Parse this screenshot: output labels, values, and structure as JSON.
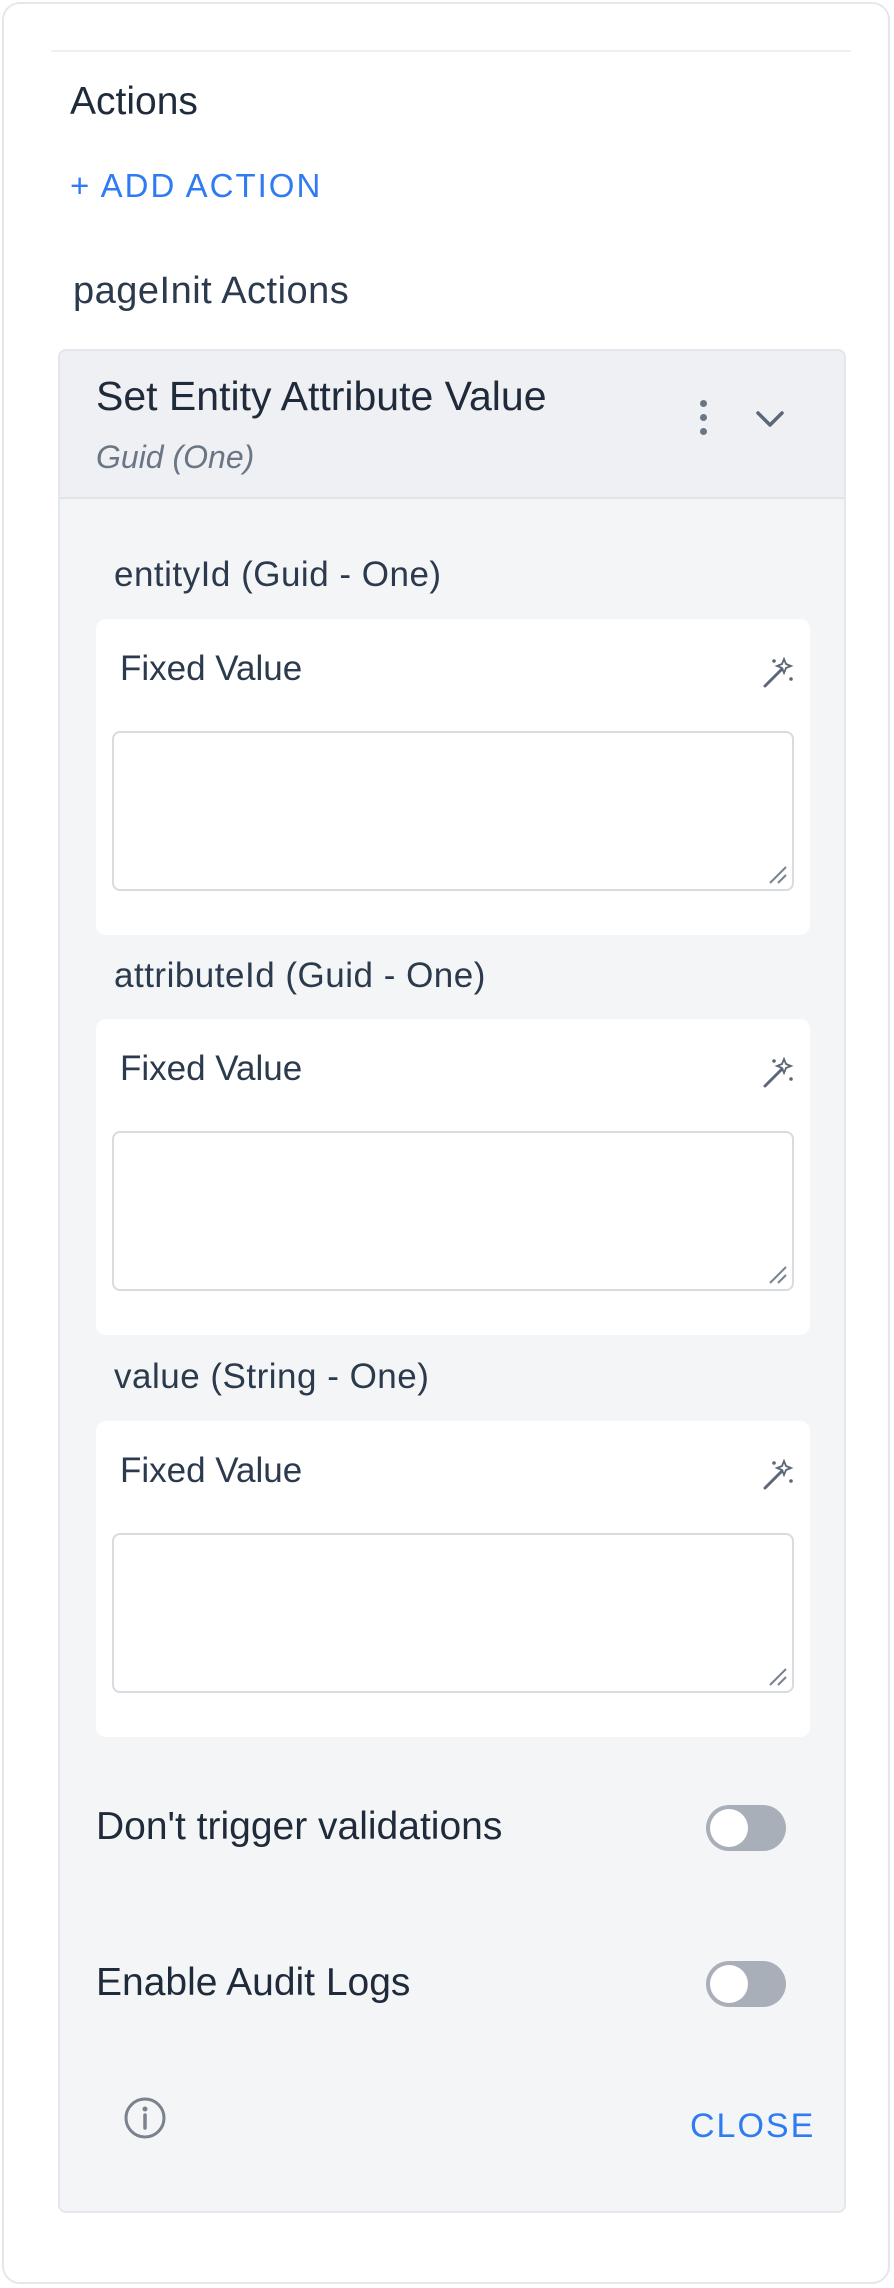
{
  "actions": {
    "heading": "Actions",
    "add_action_label": "+ ADD ACTION",
    "group_title": "pageInit Actions"
  },
  "action_card": {
    "title": "Set Entity Attribute Value",
    "subtitle": "Guid (One)",
    "icons": {
      "menu": "kebab-menu-icon",
      "collapse": "chevron-down-icon"
    },
    "params": [
      {
        "label": "entityId (Guid - One)",
        "mode_label": "Fixed Value",
        "value": "",
        "icon": "magic-wand-icon"
      },
      {
        "label": "attributeId (Guid - One)",
        "mode_label": "Fixed Value",
        "value": "",
        "icon": "magic-wand-icon"
      },
      {
        "label": "value (String - One)",
        "mode_label": "Fixed Value",
        "value": "",
        "icon": "magic-wand-icon"
      }
    ],
    "toggles": [
      {
        "label": "Don't trigger validations",
        "on": false
      },
      {
        "label": "Enable Audit Logs",
        "on": false
      }
    ],
    "footer": {
      "info_icon": "info-icon",
      "close_label": "CLOSE"
    }
  },
  "colors": {
    "accent": "#2f7bf2",
    "card_bg": "#f4f5f7",
    "toggle_off": "#a9afb8"
  }
}
